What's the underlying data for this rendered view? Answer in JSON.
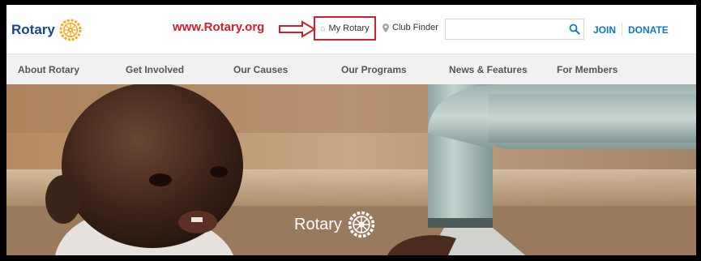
{
  "header": {
    "logo_text": "Rotary",
    "annotation_url": "www.Rotary.org",
    "my_rotary_label": "My Rotary",
    "club_finder_label": "Club Finder",
    "search_placeholder": "",
    "join_label": "JOIN",
    "donate_label": "DONATE"
  },
  "nav": {
    "items": [
      {
        "label": "About Rotary"
      },
      {
        "label": "Get Involved"
      },
      {
        "label": "Our Causes"
      },
      {
        "label": "Our Programs"
      },
      {
        "label": "News & Features"
      },
      {
        "label": "For Members"
      }
    ]
  },
  "hero": {
    "logo_text": "Rotary"
  },
  "colors": {
    "brand_blue": "#17458f",
    "link_blue": "#0c7ac0",
    "rotary_gold": "#f7a81b",
    "annotation_red": "#d0202e"
  },
  "icons": {
    "my_rotary": "home-icon",
    "club_finder": "map-pin-icon",
    "search": "search-icon"
  }
}
